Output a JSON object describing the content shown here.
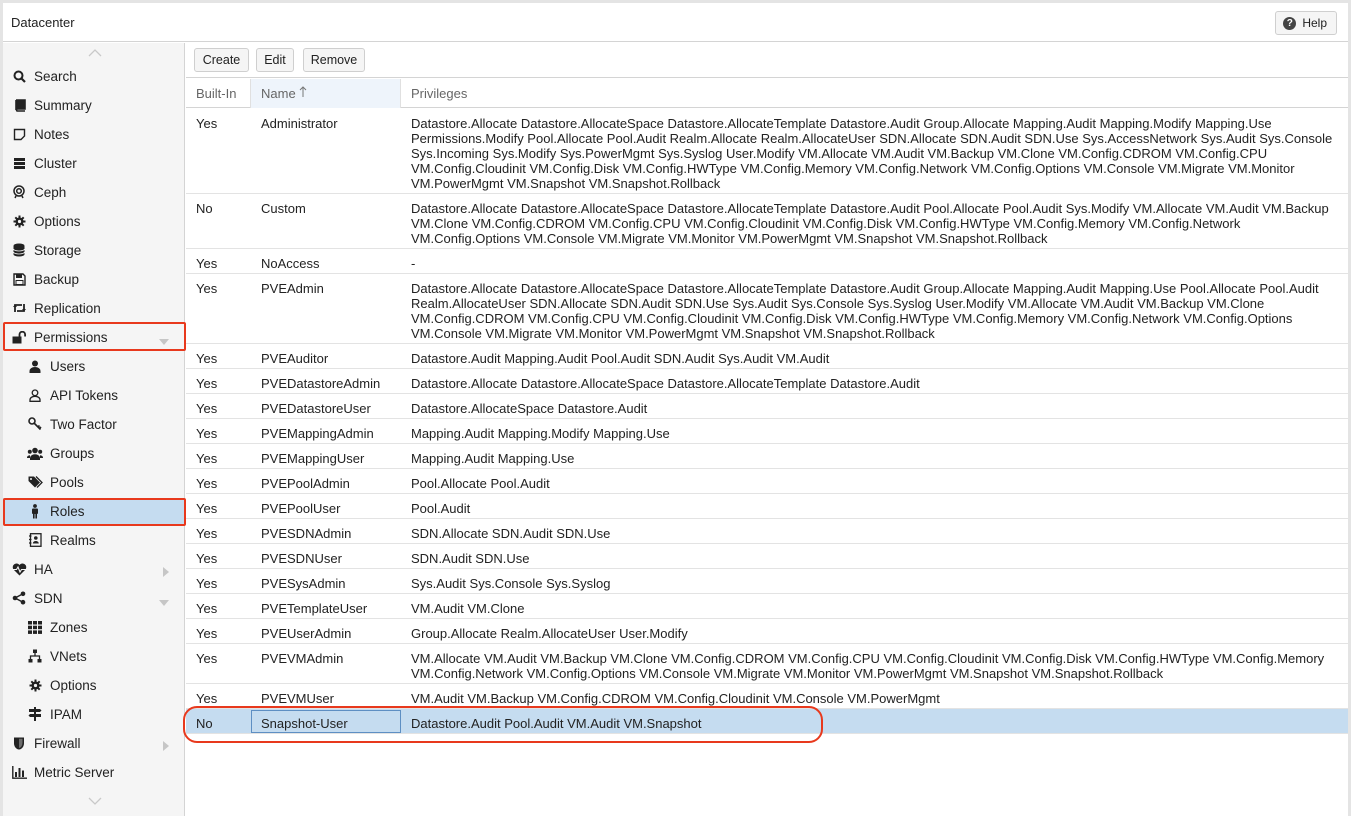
{
  "window": {
    "title": "Datacenter",
    "help_label": "Help"
  },
  "sidebar": {
    "items": [
      {
        "label": "Search",
        "icon": "search-icon",
        "level": 0
      },
      {
        "label": "Summary",
        "icon": "book-icon",
        "level": 0
      },
      {
        "label": "Notes",
        "icon": "sticky-note-icon",
        "level": 0
      },
      {
        "label": "Cluster",
        "icon": "server-icon",
        "level": 0
      },
      {
        "label": "Ceph",
        "icon": "ceph-icon",
        "level": 0
      },
      {
        "label": "Options",
        "icon": "gear-icon",
        "level": 0
      },
      {
        "label": "Storage",
        "icon": "database-icon",
        "level": 0
      },
      {
        "label": "Backup",
        "icon": "floppy-icon",
        "level": 0
      },
      {
        "label": "Replication",
        "icon": "retweet-icon",
        "level": 0
      },
      {
        "label": "Permissions",
        "icon": "unlock-icon",
        "level": 0,
        "expander": "expanded"
      },
      {
        "label": "Users",
        "icon": "user-icon",
        "level": 1
      },
      {
        "label": "API Tokens",
        "icon": "user-outline-icon",
        "level": 1
      },
      {
        "label": "Two Factor",
        "icon": "key-icon",
        "level": 1
      },
      {
        "label": "Groups",
        "icon": "users-icon",
        "level": 1
      },
      {
        "label": "Pools",
        "icon": "tags-icon",
        "level": 1
      },
      {
        "label": "Roles",
        "icon": "male-icon",
        "level": 1,
        "selected": true
      },
      {
        "label": "Realms",
        "icon": "address-book-icon",
        "level": 1
      },
      {
        "label": "HA",
        "icon": "heartbeat-icon",
        "level": 0,
        "expander": "collapsed"
      },
      {
        "label": "SDN",
        "icon": "share-alt-icon",
        "level": 0,
        "expander": "expanded"
      },
      {
        "label": "Zones",
        "icon": "th-icon",
        "level": 1
      },
      {
        "label": "VNets",
        "icon": "network-icon",
        "level": 1
      },
      {
        "label": "Options",
        "icon": "gear-icon",
        "level": 1
      },
      {
        "label": "IPAM",
        "icon": "signpost-icon",
        "level": 1
      },
      {
        "label": "Firewall",
        "icon": "shield-icon",
        "level": 0,
        "expander": "collapsed"
      },
      {
        "label": "Metric Server",
        "icon": "bar-chart-icon",
        "level": 0
      }
    ]
  },
  "toolbar": {
    "create_label": "Create",
    "edit_label": "Edit",
    "remove_label": "Remove"
  },
  "table": {
    "columns": {
      "builtin": "Built-In",
      "name": "Name",
      "privileges": "Privileges"
    },
    "rows": [
      {
        "builtin": "Yes",
        "name": "Administrator",
        "privileges": "Datastore.Allocate Datastore.AllocateSpace Datastore.AllocateTemplate Datastore.Audit Group.Allocate Mapping.Audit Mapping.Modify Mapping.Use Permissions.Modify Pool.Allocate Pool.Audit Realm.Allocate Realm.AllocateUser SDN.Allocate SDN.Audit SDN.Use Sys.AccessNetwork Sys.Audit Sys.Console Sys.Incoming Sys.Modify Sys.PowerMgmt Sys.Syslog User.Modify VM.Allocate VM.Audit VM.Backup VM.Clone VM.Config.CDROM VM.Config.CPU VM.Config.Cloudinit VM.Config.Disk VM.Config.HWType VM.Config.Memory VM.Config.Network VM.Config.Options VM.Console VM.Migrate VM.Monitor VM.PowerMgmt VM.Snapshot VM.Snapshot.Rollback"
      },
      {
        "builtin": "No",
        "name": "Custom",
        "privileges": "Datastore.Allocate Datastore.AllocateSpace Datastore.AllocateTemplate Datastore.Audit Pool.Allocate Pool.Audit Sys.Modify VM.Allocate VM.Audit VM.Backup VM.Clone VM.Config.CDROM VM.Config.CPU VM.Config.Cloudinit VM.Config.Disk VM.Config.HWType VM.Config.Memory VM.Config.Network VM.Config.Options VM.Console VM.Migrate VM.Monitor VM.PowerMgmt VM.Snapshot VM.Snapshot.Rollback"
      },
      {
        "builtin": "Yes",
        "name": "NoAccess",
        "privileges": "-"
      },
      {
        "builtin": "Yes",
        "name": "PVEAdmin",
        "privileges": "Datastore.Allocate Datastore.AllocateSpace Datastore.AllocateTemplate Datastore.Audit Group.Allocate Mapping.Audit Mapping.Use Pool.Allocate Pool.Audit Realm.AllocateUser SDN.Allocate SDN.Audit SDN.Use Sys.Audit Sys.Console Sys.Syslog User.Modify VM.Allocate VM.Audit VM.Backup VM.Clone VM.Config.CDROM VM.Config.CPU VM.Config.Cloudinit VM.Config.Disk VM.Config.HWType VM.Config.Memory VM.Config.Network VM.Config.Options VM.Console VM.Migrate VM.Monitor VM.PowerMgmt VM.Snapshot VM.Snapshot.Rollback"
      },
      {
        "builtin": "Yes",
        "name": "PVEAuditor",
        "privileges": "Datastore.Audit Mapping.Audit Pool.Audit SDN.Audit Sys.Audit VM.Audit"
      },
      {
        "builtin": "Yes",
        "name": "PVEDatastoreAdmin",
        "privileges": "Datastore.Allocate Datastore.AllocateSpace Datastore.AllocateTemplate Datastore.Audit"
      },
      {
        "builtin": "Yes",
        "name": "PVEDatastoreUser",
        "privileges": "Datastore.AllocateSpace Datastore.Audit"
      },
      {
        "builtin": "Yes",
        "name": "PVEMappingAdmin",
        "privileges": "Mapping.Audit Mapping.Modify Mapping.Use"
      },
      {
        "builtin": "Yes",
        "name": "PVEMappingUser",
        "privileges": "Mapping.Audit Mapping.Use"
      },
      {
        "builtin": "Yes",
        "name": "PVEPoolAdmin",
        "privileges": "Pool.Allocate Pool.Audit"
      },
      {
        "builtin": "Yes",
        "name": "PVEPoolUser",
        "privileges": "Pool.Audit"
      },
      {
        "builtin": "Yes",
        "name": "PVESDNAdmin",
        "privileges": "SDN.Allocate SDN.Audit SDN.Use"
      },
      {
        "builtin": "Yes",
        "name": "PVESDNUser",
        "privileges": "SDN.Audit SDN.Use"
      },
      {
        "builtin": "Yes",
        "name": "PVESysAdmin",
        "privileges": "Sys.Audit Sys.Console Sys.Syslog"
      },
      {
        "builtin": "Yes",
        "name": "PVETemplateUser",
        "privileges": "VM.Audit VM.Clone"
      },
      {
        "builtin": "Yes",
        "name": "PVEUserAdmin",
        "privileges": "Group.Allocate Realm.AllocateUser User.Modify"
      },
      {
        "builtin": "Yes",
        "name": "PVEVMAdmin",
        "privileges": "VM.Allocate VM.Audit VM.Backup VM.Clone VM.Config.CDROM VM.Config.CPU VM.Config.Cloudinit VM.Config.Disk VM.Config.HWType VM.Config.Memory VM.Config.Network VM.Config.Options VM.Console VM.Migrate VM.Monitor VM.PowerMgmt VM.Snapshot VM.Snapshot.Rollback"
      },
      {
        "builtin": "Yes",
        "name": "PVEVMUser",
        "privileges": "VM.Audit VM.Backup VM.Config.CDROM VM.Config.Cloudinit VM.Console VM.PowerMgmt"
      },
      {
        "builtin": "No",
        "name": "Snapshot-User",
        "privileges": "Datastore.Audit Pool.Audit VM.Audit VM.Snapshot",
        "selected": true
      }
    ]
  },
  "colors": {
    "selection": "#c5dcf0",
    "annotation_red": "#e8391d",
    "sidebar_bg": "#f5f5f5"
  }
}
